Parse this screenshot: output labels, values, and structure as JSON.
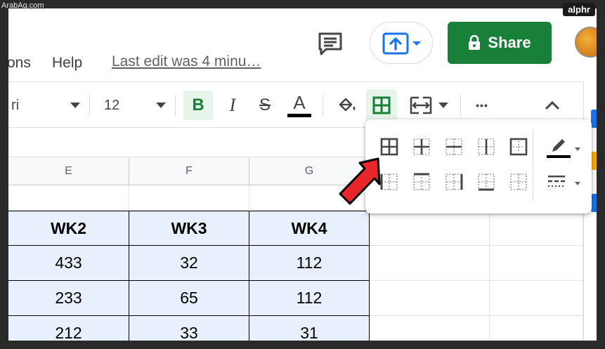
{
  "watermark": {
    "left": "ArabAq.com",
    "right": "alphr"
  },
  "menu": {
    "partial_item": "ons",
    "help": "Help",
    "last_edit": "Last edit was 4 minu…"
  },
  "header": {
    "share_label": "Share"
  },
  "toolbar": {
    "font_partial": "ri",
    "font_size": "12",
    "bold": "B",
    "italic": "I",
    "strike": "S",
    "text_color": "A",
    "more": "•••"
  },
  "columns": [
    "E",
    "F",
    "G"
  ],
  "table": {
    "headers": [
      "WK2",
      "WK3",
      "WK4"
    ],
    "rows": [
      [
        "433",
        "32",
        "112"
      ],
      [
        "233",
        "65",
        "112"
      ],
      [
        "212",
        "33",
        "31"
      ]
    ]
  },
  "colors": {
    "share_green": "#188038",
    "accent_blue": "#1a73e8",
    "selection_fill": "#e8f0fe",
    "active_green": "#188038",
    "arrow_red": "#e8262a"
  },
  "borders_popup": {
    "row1": [
      "all-borders-icon",
      "inner-borders-icon",
      "horizontal-borders-icon",
      "vertical-borders-icon",
      "outer-borders-icon"
    ],
    "row2": [
      "left-border-icon",
      "top-border-icon",
      "right-border-icon",
      "bottom-border-icon",
      "clear-borders-icon"
    ],
    "tools": [
      "border-color-icon",
      "border-style-icon"
    ]
  }
}
